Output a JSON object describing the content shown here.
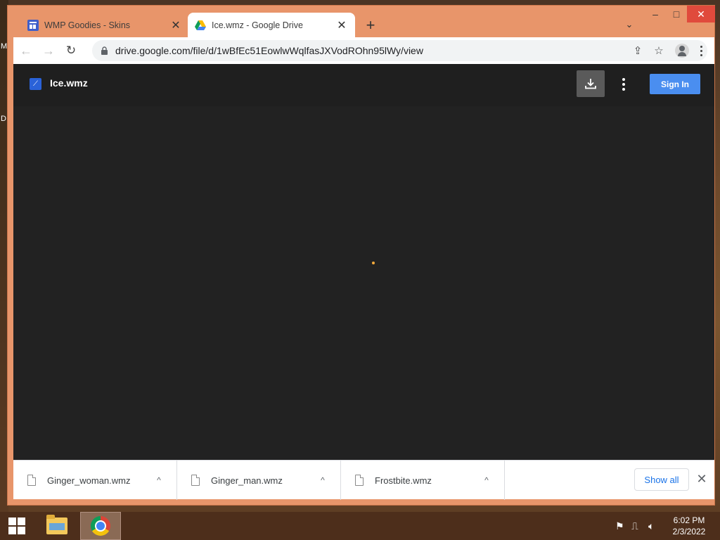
{
  "desktop": {
    "left_glyph_1": "M",
    "left_glyph_2": "D"
  },
  "browser": {
    "tabs": [
      {
        "title": "WMP Goodies - Skins",
        "favicon": "wmp-goodies-icon",
        "active": false
      },
      {
        "title": "Ice.wmz - Google Drive",
        "favicon": "google-drive-icon",
        "active": true
      }
    ],
    "new_tab_symbol": "+",
    "tab_search_symbol": "⌄",
    "window_controls": {
      "minimize": "–",
      "maximize": "□",
      "close": "✕"
    },
    "toolbar": {
      "back": "←",
      "forward": "→",
      "reload": "↻",
      "url": "drive.google.com/file/d/1wBfEc51EowlwWqlfasJXVodROhn95lWy/view",
      "share_icon": "⇪",
      "star_icon": "☆"
    }
  },
  "drive": {
    "file_name": "Ice.wmz",
    "file_icon_glyph": "⟋",
    "sign_in_label": "Sign In",
    "spinner_color": "#f2a93b"
  },
  "downloads": {
    "items": [
      {
        "name": "Ginger_woman.wmz"
      },
      {
        "name": "Ginger_man.wmz"
      },
      {
        "name": "Frostbite.wmz"
      }
    ],
    "caret": "^",
    "show_all_label": "Show all",
    "close_symbol": "✕"
  },
  "taskbar": {
    "apps": [
      "file-explorer",
      "google-chrome"
    ],
    "time": "6:02 PM",
    "date": "2/3/2022"
  },
  "colors": {
    "window_frame": "#e8956a",
    "window_close": "#e04a3c",
    "drive_bg": "#222222",
    "sign_in": "#4a8ef0",
    "taskbar": "#4d2e1b"
  }
}
